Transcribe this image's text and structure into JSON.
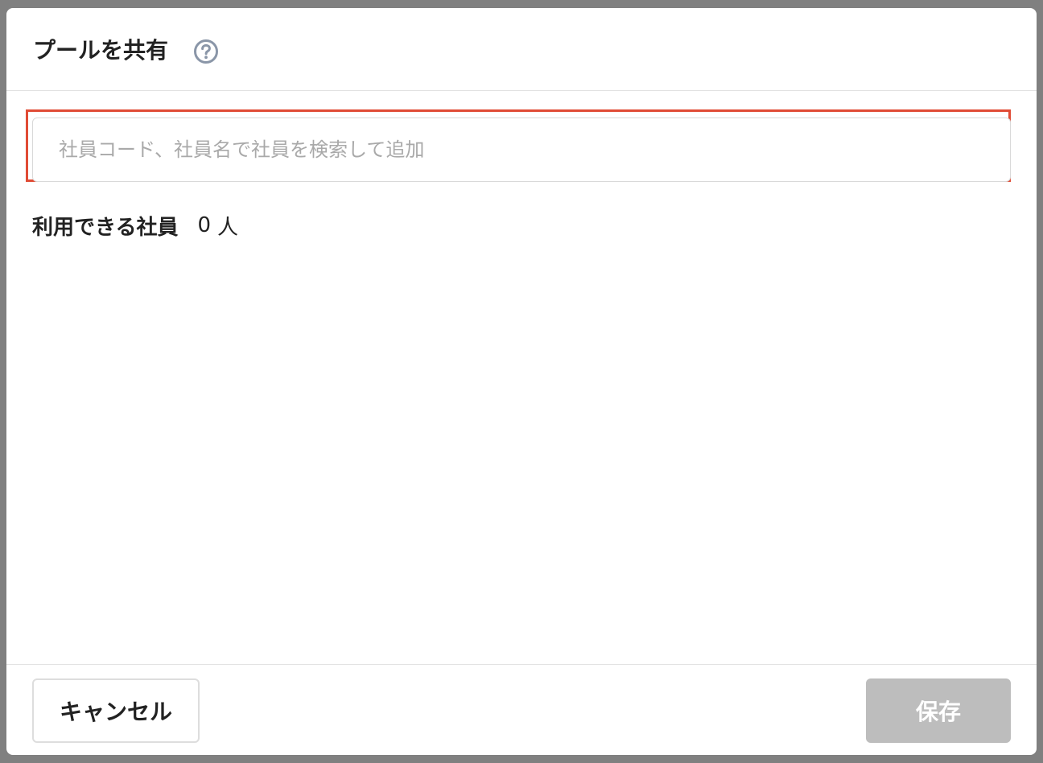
{
  "dialog": {
    "title": "プールを共有",
    "help_icon": "question-circle-icon"
  },
  "search": {
    "placeholder": "社員コード、社員名で社員を検索して追加",
    "value": ""
  },
  "available": {
    "label": "利用できる社員",
    "count": "0",
    "unit": "人"
  },
  "footer": {
    "cancel_label": "キャンセル",
    "save_label": "保存",
    "save_enabled": false
  },
  "colors": {
    "highlight": "#e04b35",
    "save_disabled_bg": "#bdbdbd",
    "backdrop": "#808080",
    "help_icon": "#8a96a8"
  }
}
